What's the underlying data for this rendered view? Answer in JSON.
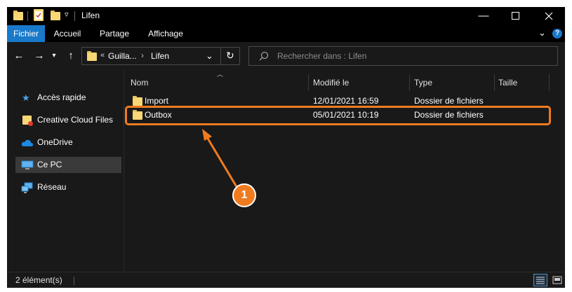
{
  "window": {
    "title": "Lifen"
  },
  "ribbon": {
    "tabs": [
      "Fichier",
      "Accueil",
      "Partage",
      "Affichage"
    ]
  },
  "address": {
    "crumbs": [
      "«",
      "Guilla...",
      "Lifen"
    ]
  },
  "search": {
    "placeholder": "Rechercher dans : Lifen"
  },
  "sidebar": {
    "items": [
      "Accès rapide",
      "Creative Cloud Files",
      "OneDrive",
      "Ce PC",
      "Réseau"
    ]
  },
  "columns": {
    "name": "Nom",
    "modified": "Modifié le",
    "type": "Type",
    "size": "Taille"
  },
  "files": [
    {
      "name": "Import",
      "modified": "12/01/2021 16:59",
      "type": "Dossier de fichiers"
    },
    {
      "name": "Outbox",
      "modified": "05/01/2021 10:19",
      "type": "Dossier de fichiers"
    }
  ],
  "status": {
    "count": "2 élément(s)"
  },
  "annotation": {
    "number": "1",
    "color": "#f07b1f"
  },
  "colors": {
    "accent": "#1979ca",
    "folder": "#f8d775"
  },
  "icons": [
    "folder-icon",
    "checkmark-icon",
    "minimize-icon",
    "maximize-icon",
    "close-icon",
    "help-icon",
    "back-arrow-icon",
    "forward-arrow-icon",
    "up-arrow-icon",
    "refresh-icon",
    "search-icon",
    "star-icon",
    "cloud-icon",
    "pc-icon",
    "network-icon",
    "details-view-icon",
    "large-icons-view-icon"
  ]
}
